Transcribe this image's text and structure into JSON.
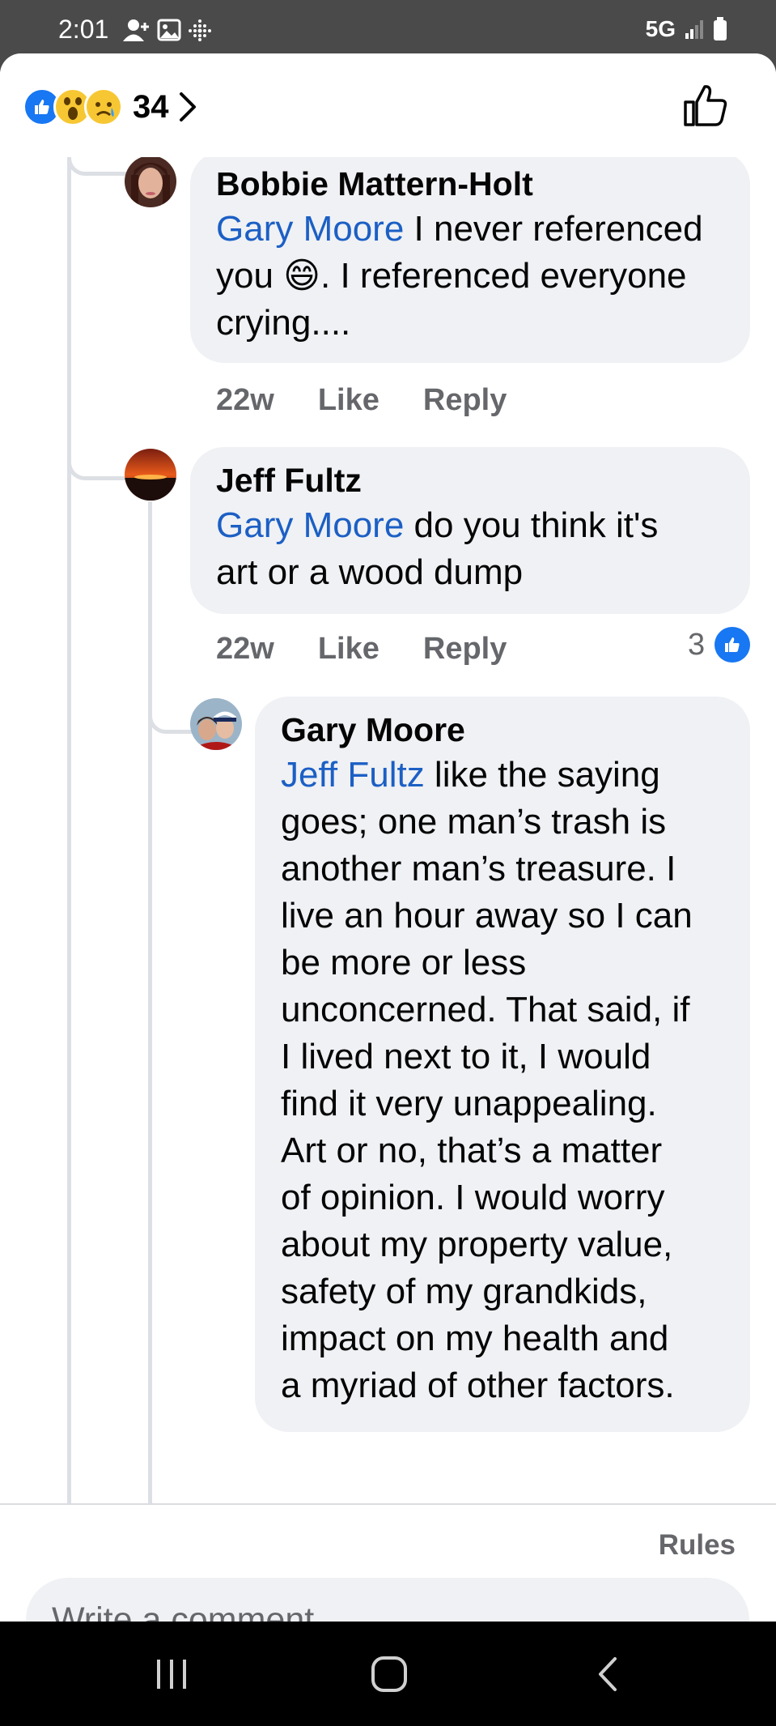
{
  "status_bar": {
    "time": "2:01",
    "network": "5G"
  },
  "header": {
    "reaction_icons": [
      "like-reaction-icon",
      "wow-reaction-icon",
      "sad-reaction-icon"
    ],
    "reaction_count": "34"
  },
  "comments": [
    {
      "author": "Bobbie Mattern-Holt",
      "mention": "Gary Moore",
      "text_lines": [
        " I never referenced",
        "you 😄.  I referenced everyone",
        "crying...."
      ],
      "time": "22w",
      "like": "Like",
      "reply": "Reply"
    },
    {
      "author": "Jeff Fultz",
      "mention": "Gary Moore",
      "text_lines": [
        " do you think it's",
        "art or a wood dump"
      ],
      "time": "22w",
      "like": "Like",
      "reply": "Reply",
      "reaction_count": "3"
    },
    {
      "author": "Gary Moore",
      "mention": "Jeff Fultz",
      "text_lines": [
        " like the saying",
        "goes; one man’s trash is",
        "another man’s treasure. I",
        "live an hour away so I can",
        "be more or less",
        "unconcerned. That said, if",
        "I lived next to it, I would",
        "find it very unappealing.",
        "Art or no, that’s a matter",
        "of opinion. I would worry",
        "about my property value,",
        "safety of my grandkids,",
        "impact on my health and",
        "a myriad of other factors."
      ]
    }
  ],
  "composer": {
    "rules": "Rules",
    "placeholder": "Write a comment…"
  },
  "colors": {
    "accent_blue": "#1877f2",
    "mention_blue": "#1c5fc5",
    "bubble_bg": "#eff1f4",
    "meta_gray": "#65676b"
  }
}
